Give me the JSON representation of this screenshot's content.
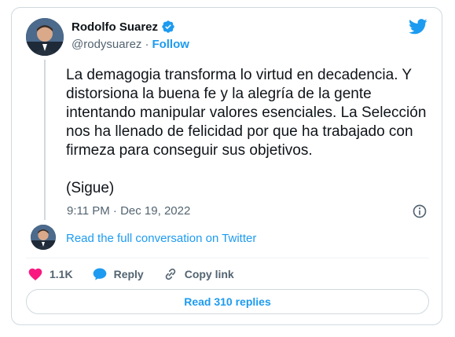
{
  "author": {
    "name": "Rodolfo Suarez",
    "handle": "@rodysuarez",
    "separator": "·",
    "follow_label": "Follow"
  },
  "tweet": {
    "text": "La demagogia transforma lo virtud en decadencia. Y distorsiona la buena fe y la alegría de la gente intentando manipular valores esenciales. La Selección nos ha llenado de felicidad por que ha trabajado con firmeza para conseguir sus objetivos.\n\n(Sigue)",
    "timestamp": "9:11 PM · Dec 19, 2022"
  },
  "conversation": {
    "read_label": "Read the full conversation on Twitter"
  },
  "actions": {
    "likes": "1.1K",
    "reply_label": "Reply",
    "copy_label": "Copy link"
  },
  "replies_button": "Read 310 replies",
  "colors": {
    "accent": "#1d9bf0",
    "like": "#f91880",
    "text": "#0f1419",
    "secondary": "#536471"
  },
  "icons": [
    "verified-badge-icon",
    "twitter-bird-icon",
    "info-icon",
    "heart-icon",
    "reply-bubble-icon",
    "link-icon"
  ]
}
